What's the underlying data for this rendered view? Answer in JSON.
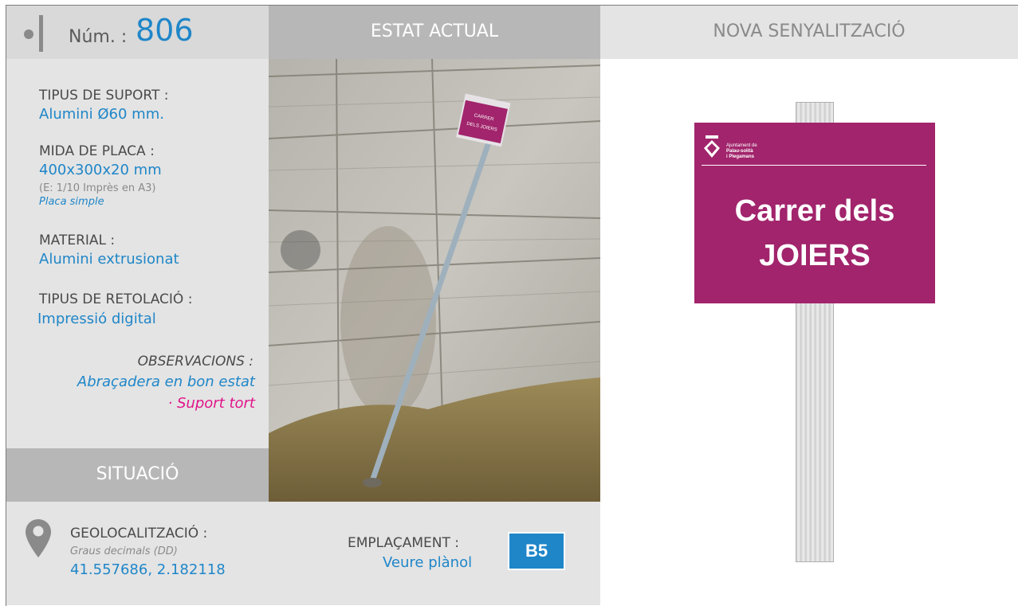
{
  "header": {
    "num_label": "Núm. :",
    "num_value": "806",
    "estat_actual": "ESTAT ACTUAL",
    "nova_senyalitzacio": "NOVA SENYALITZACIÓ"
  },
  "fields": {
    "tipus_suport_label": "TIPUS DE SUPORT :",
    "tipus_suport_value": "Alumini Ø60 mm.",
    "mida_placa_label": "MIDA DE PLACA :",
    "mida_placa_value": "400x300x20 mm",
    "mida_placa_scale": "(E: 1/10 Imprès en A3)",
    "mida_placa_type": "Placa simple",
    "material_label": "MATERIAL :",
    "material_value": "Alumini extrusionat",
    "retolacio_label": "TIPUS DE RETOLACIÓ :",
    "retolacio_value": "Impressió digital",
    "observacions_label": "OBSERVACIONS :",
    "observacions_value": "Abraçadera en bon estat",
    "observacions_alert": "· Suport tort"
  },
  "situacio": {
    "title": "SITUACIÓ",
    "geo_label": "GEOLOCALITZACIÓ :",
    "geo_format": "Graus decimals (DD)",
    "geo_value": "41.557686, 2.182118",
    "emplacament_label": "EMPLAÇAMENT :",
    "emplacament_link": "Veure plànol",
    "emplacament_code": "B5"
  },
  "photo": {
    "sign_line1": "CARRER",
    "sign_line2": "DELS JOIERS"
  },
  "new_sign": {
    "logo_line1": "Ajuntament de",
    "logo_line2": "Palau-solità",
    "logo_line3": "i Plegamans",
    "line1": "Carrer dels",
    "line2": "JOIERS",
    "plate_color": "#a1246c"
  },
  "colors": {
    "accent_blue": "#1f86c8",
    "alert_pink": "#e0158a"
  }
}
